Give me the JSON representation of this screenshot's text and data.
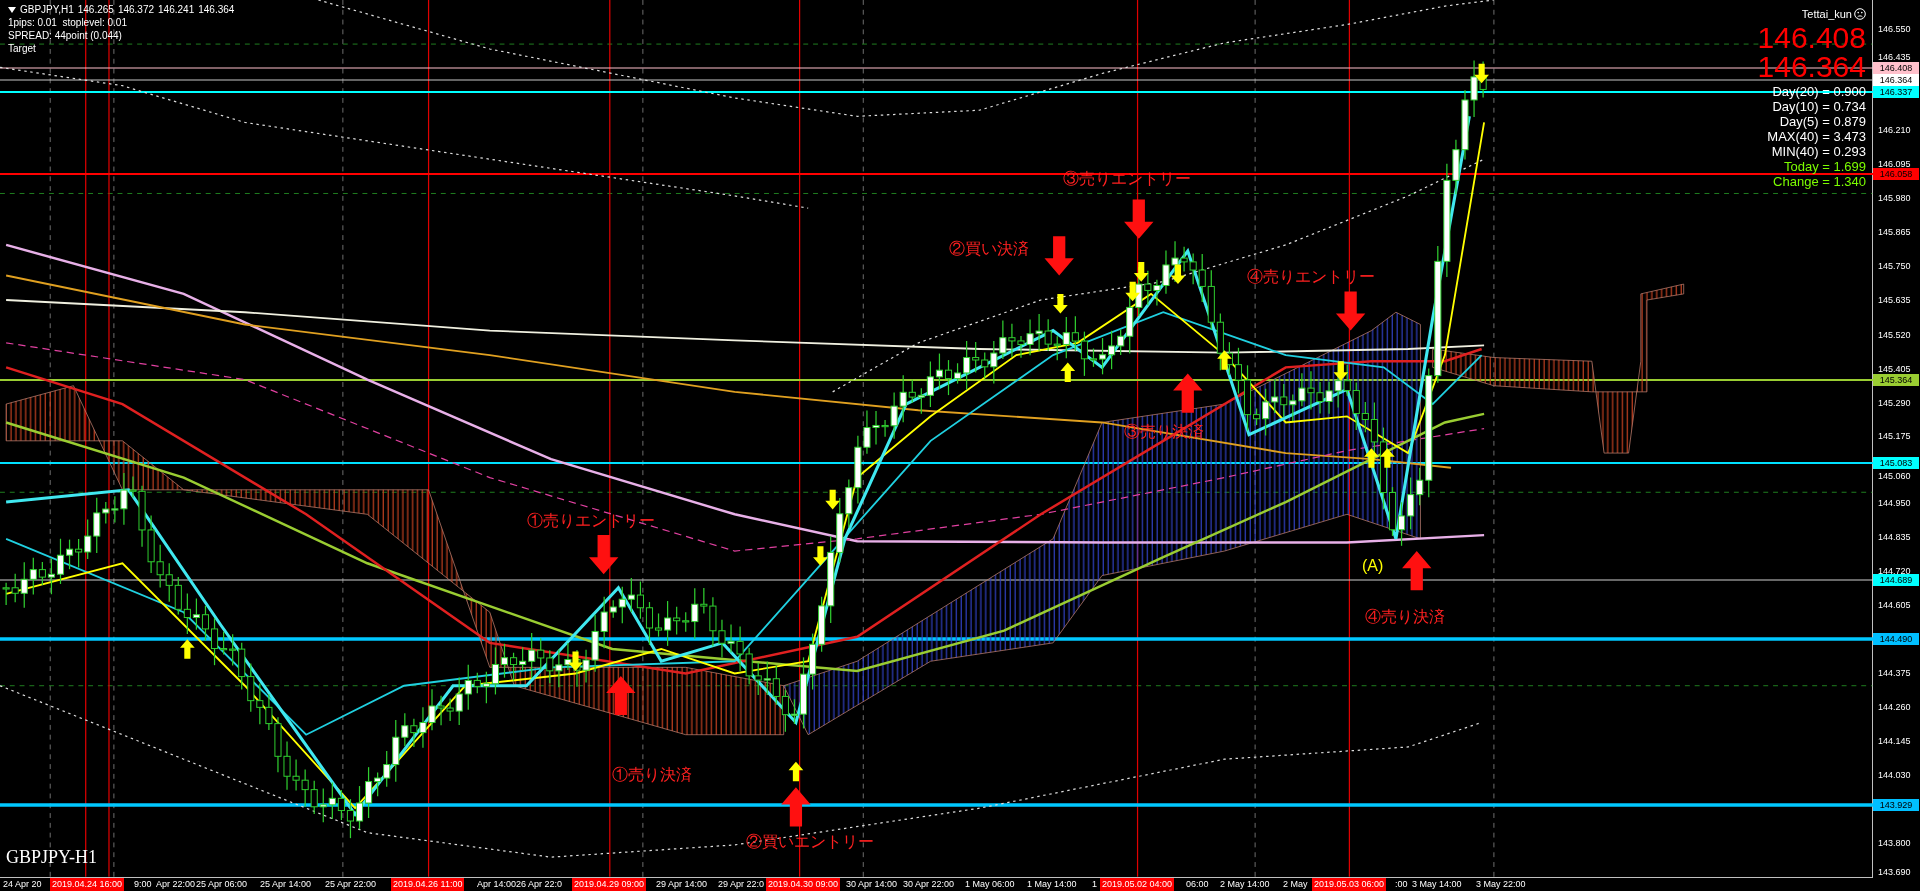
{
  "header": {
    "symbol": "GBPJPY,H1",
    "ohlc": [
      "146.265",
      "146.372",
      "146.241",
      "146.364"
    ]
  },
  "info_lines": [
    "1pips: 0.01  stoplevel: 0.01",
    "SPREAD: 44point (0.044)",
    "Target"
  ],
  "account": "Tettai_kun",
  "big_prices": [
    "146.408",
    "146.364"
  ],
  "stats": [
    {
      "text": "Day(20) = 0.900",
      "color": "#ffffff"
    },
    {
      "text": "Day(10) = 0.734",
      "color": "#ffffff"
    },
    {
      "text": "Day(5) = 0.879",
      "color": "#ffffff"
    },
    {
      "text": "MAX(40) = 3.473",
      "color": "#ffffff"
    },
    {
      "text": "MIN(40) = 0.293",
      "color": "#ffffff"
    },
    {
      "text": "Today = 1.699",
      "color": "#7cfc00"
    },
    {
      "text": "Change = 1.340",
      "color": "#7cfc00"
    }
  ],
  "chart_label": "GBPJPY-H1",
  "annotations": [
    {
      "text": "③売りエントリー",
      "color": "#ff2020"
    },
    {
      "text": "②買い決済",
      "color": "#ff2020"
    },
    {
      "text": "④売りエントリー",
      "color": "#ff2020"
    },
    {
      "text": "①売りエントリー",
      "color": "#ff2020"
    },
    {
      "text": "③売り決済",
      "color": "#ff2020"
    },
    {
      "text": "(A)",
      "color": "#ffff00"
    },
    {
      "text": "④売り決済",
      "color": "#ff2020"
    },
    {
      "text": "①売り決済",
      "color": "#ff2020"
    },
    {
      "text": "②買いエントリー",
      "color": "#ff2020"
    }
  ],
  "price_ticks": [
    "146.550",
    "146.435",
    "146.210",
    "146.095",
    "145.980",
    "145.865",
    "145.750",
    "145.635",
    "145.520",
    "145.405",
    "145.290",
    "145.175",
    "145.060",
    "144.950",
    "144.835",
    "144.720",
    "144.605",
    "144.375",
    "144.260",
    "144.145",
    "144.030",
    "143.800",
    "143.690"
  ],
  "price_lines": [
    {
      "label": "146.408",
      "color": "#ffc0cb"
    },
    {
      "label": "146.364",
      "color": "#ffffff"
    },
    {
      "label": "146.337",
      "color": "#00ffff"
    },
    {
      "label": "146.058",
      "color": "#ff0000"
    },
    {
      "label": "145.364",
      "color": "#9acd32"
    },
    {
      "label": "145.083",
      "color": "#00ffff"
    },
    {
      "label": "144.689",
      "color": "#00ffff"
    },
    {
      "label": "144.490",
      "color": "#00bfff"
    },
    {
      "label": "143.929",
      "color": "#00bfff"
    }
  ],
  "time_labels": [
    {
      "text": "24 Apr 20",
      "kind": "normal"
    },
    {
      "text": "2019.04.24 16:00",
      "kind": "marker"
    },
    {
      "text": "9:00",
      "kind": "normal"
    },
    {
      "text": "Apr 22:00",
      "kind": "normal"
    },
    {
      "text": "25 Apr 06:00",
      "kind": "normal"
    },
    {
      "text": "25 Apr 14:00",
      "kind": "normal"
    },
    {
      "text": "25 Apr 22:00",
      "kind": "normal"
    },
    {
      "text": "2019.04.26 11:00",
      "kind": "marker"
    },
    {
      "text": "Apr 14:00",
      "kind": "normal"
    },
    {
      "text": "26 Apr 22:0",
      "kind": "normal"
    },
    {
      "text": "2019.04.29 09:00",
      "kind": "marker"
    },
    {
      "text": "29 Apr 14:00",
      "kind": "normal"
    },
    {
      "text": "29 Apr 22:0",
      "kind": "normal"
    },
    {
      "text": "2019.04.30 09:00",
      "kind": "marker"
    },
    {
      "text": "30 Apr 14:00",
      "kind": "normal"
    },
    {
      "text": "30 Apr 22:00",
      "kind": "normal"
    },
    {
      "text": "1 May 06:00",
      "kind": "normal"
    },
    {
      "text": "1 May 14:00",
      "kind": "normal"
    },
    {
      "text": "1",
      "kind": "normal"
    },
    {
      "text": "2019.05.02 04:00",
      "kind": "marker"
    },
    {
      "text": "06:00",
      "kind": "normal"
    },
    {
      "text": "2 May 14:00",
      "kind": "normal"
    },
    {
      "text": "2 May",
      "kind": "normal"
    },
    {
      "text": "2019.05.03 06:00",
      "kind": "marker"
    },
    {
      "text": ":00",
      "kind": "normal"
    },
    {
      "text": "3 May 14:00",
      "kind": "normal"
    },
    {
      "text": "3 May 22:00",
      "kind": "normal"
    }
  ]
}
